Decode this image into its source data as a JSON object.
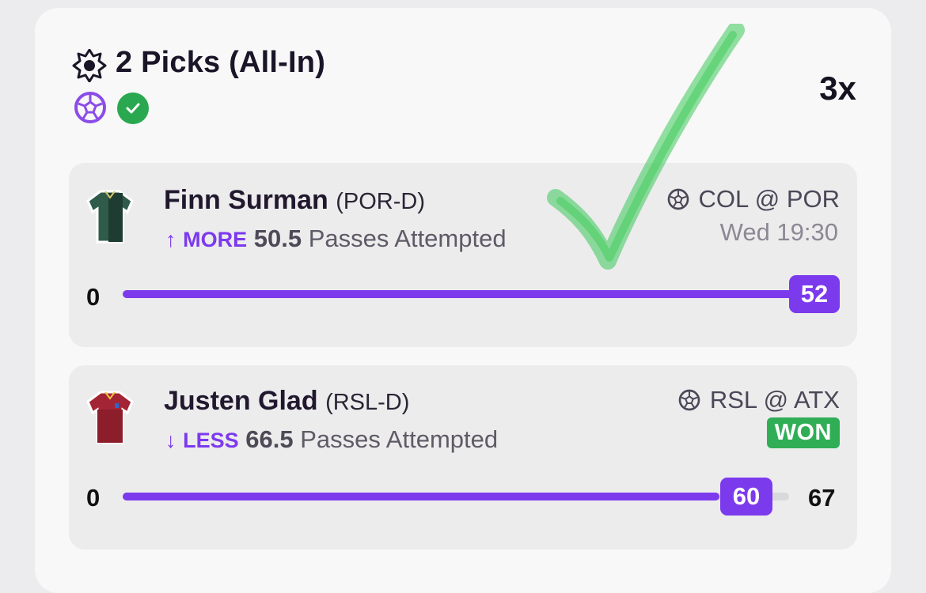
{
  "header": {
    "title": "2 Picks (All-In)",
    "multiplier": "3x",
    "status_icons": [
      "soccer-ball-icon",
      "check-icon"
    ]
  },
  "picks": [
    {
      "player": "Finn Surman",
      "position": "(POR-D)",
      "direction_arrow": "↑",
      "direction": "MORE",
      "line": "50.5",
      "stat": "Passes Attempted",
      "matchup": "COL @ POR",
      "time": "Wed 19:30",
      "progress_min": "0",
      "current": "52",
      "progress_fraction": 1.0
    },
    {
      "player": "Justen Glad",
      "position": "(RSL-D)",
      "direction_arrow": "↓",
      "direction": "LESS",
      "line": "66.5",
      "stat": "Passes Attempted",
      "matchup": "RSL @ ATX",
      "result": "WON",
      "progress_min": "0",
      "current": "60",
      "progress_max": "67",
      "progress_fraction": 0.896
    }
  ],
  "colors": {
    "accent": "#7c3aed",
    "win": "#2fae56",
    "check_mark": "#3cc85a",
    "jersey_por": "#2f5b4b",
    "jersey_rsl": "#a32434"
  }
}
